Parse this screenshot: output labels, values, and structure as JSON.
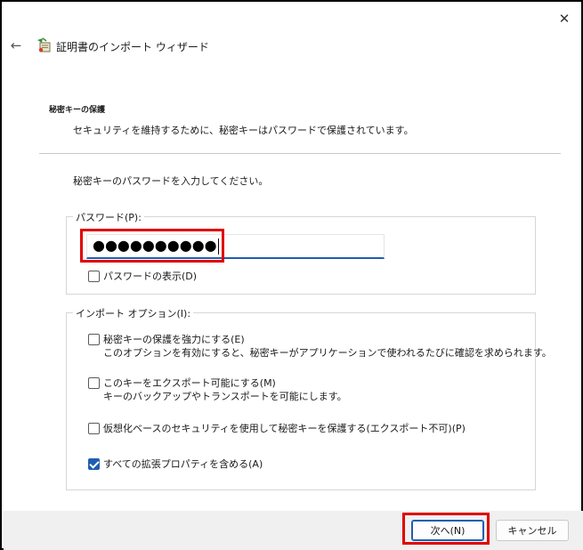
{
  "window": {
    "close_glyph": "✕"
  },
  "header": {
    "back_glyph": "←",
    "title": "証明書のインポート ウィザード",
    "icon": "certificate-wizard-icon"
  },
  "section": {
    "title": "秘密キーの保護",
    "description": "セキュリティを維持するために、秘密キーはパスワードで保護されています。"
  },
  "prompt": "秘密キーのパスワードを入力してください。",
  "password_group": {
    "legend": "パスワード(P):",
    "value": "●●●●●●●●●●",
    "show_password": {
      "label": "パスワードの表示(D)",
      "checked": false
    }
  },
  "import_options": {
    "legend": "インポート オプション(I):",
    "options": [
      {
        "label": "秘密キーの保護を強力にする(E)",
        "sub": "このオプションを有効にすると、秘密キーがアプリケーションで使われるたびに確認を求められます。",
        "checked": false
      },
      {
        "label": "このキーをエクスポート可能にする(M)",
        "sub": "キーのバックアップやトランスポートを可能にします。",
        "checked": false
      },
      {
        "label": "仮想化ベースのセキュリティを使用して秘密キーを保護する(エクスポート不可)(P)",
        "sub": "",
        "checked": false
      },
      {
        "label": "すべての拡張プロパティを含める(A)",
        "sub": "",
        "checked": true
      }
    ]
  },
  "footer": {
    "next_label": "次へ(N)",
    "cancel_label": "キャンセル"
  },
  "colors": {
    "accent": "#1f5eb0",
    "highlight": "#e00000"
  }
}
